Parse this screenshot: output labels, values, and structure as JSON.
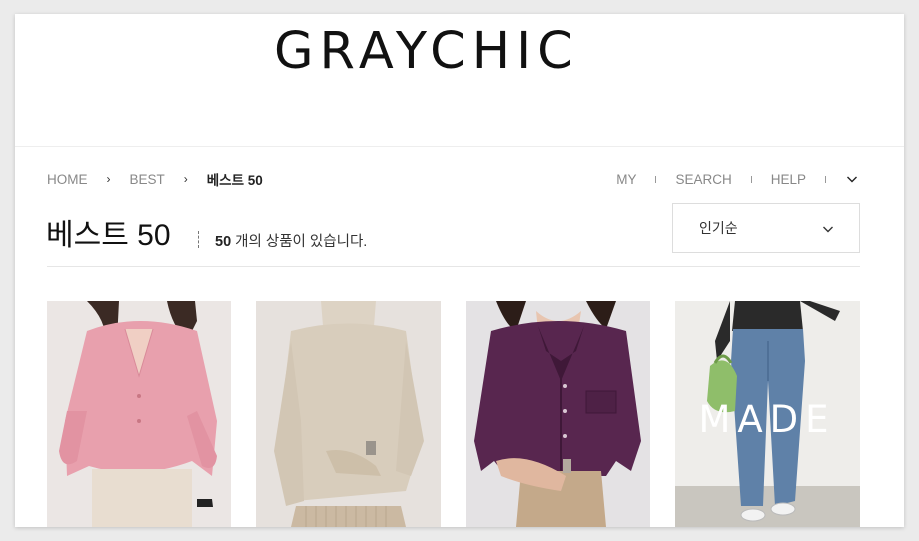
{
  "brand": {
    "logo": "GRAYCHIC"
  },
  "breadcrumb": {
    "items": [
      "HOME",
      "BEST",
      "베스트 50"
    ],
    "separator": "›"
  },
  "top_menu": {
    "items": [
      "MY",
      "SEARCH",
      "HELP"
    ],
    "more_icon": "chevron-down-icon"
  },
  "page": {
    "title": "베스트 50",
    "count_number": "50",
    "count_suffix": " 개의 상품이 있습니다."
  },
  "sort": {
    "selected": "인기순",
    "icon": "chevron-down-icon"
  },
  "products": [
    {
      "name": "pink-fluffy-cardigan",
      "color": "#e9a3ad"
    },
    {
      "name": "beige-turtleneck",
      "color": "#ddd4c6"
    },
    {
      "name": "purple-corduroy-shirt",
      "color": "#54254f"
    },
    {
      "name": "made-wide-jeans",
      "badge": "MADE",
      "color": "#5b7fa6"
    }
  ]
}
